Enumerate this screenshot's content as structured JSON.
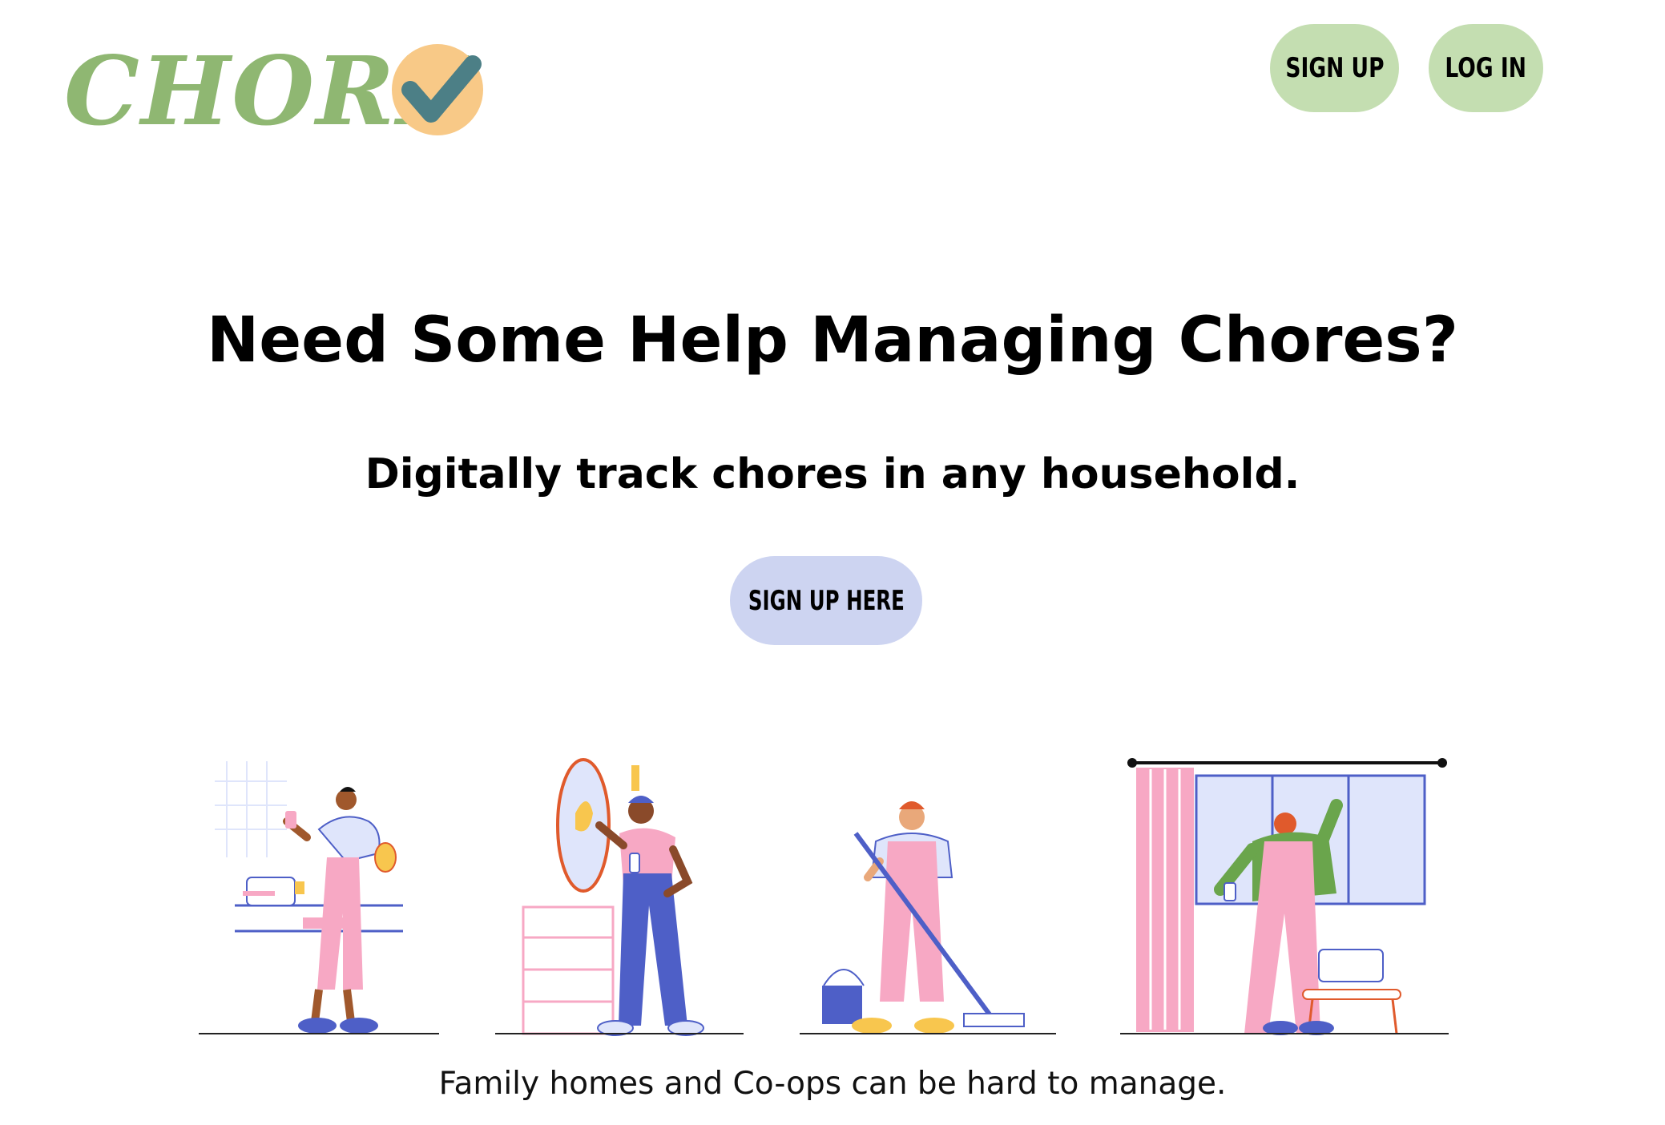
{
  "header": {
    "logo_text": "CHORE",
    "signup_label": "SIGN UP",
    "login_label": "LOG IN"
  },
  "hero": {
    "title": "Need Some Help Managing Chores?",
    "subtitle": "Digitally track chores in any household.",
    "cta_label": "SIGN UP HERE"
  },
  "illustrations": [
    {
      "name": "person-cleaning-bathroom"
    },
    {
      "name": "person-wiping-mirror"
    },
    {
      "name": "person-mopping-floor"
    },
    {
      "name": "person-cleaning-window"
    }
  ],
  "caption": "Family homes and Co-ops can be hard to manage.",
  "colors": {
    "logo_green": "#8fb772",
    "check_circle": "#f8c987",
    "check_mark": "#4c7f86",
    "nav_button_bg": "#c4deb1",
    "cta_bg": "#cdd4f1",
    "pink": "#f7a8c4",
    "blue": "#4e5fc7",
    "light_blue": "#dfe5fb",
    "green_shirt": "#6aa54c"
  }
}
